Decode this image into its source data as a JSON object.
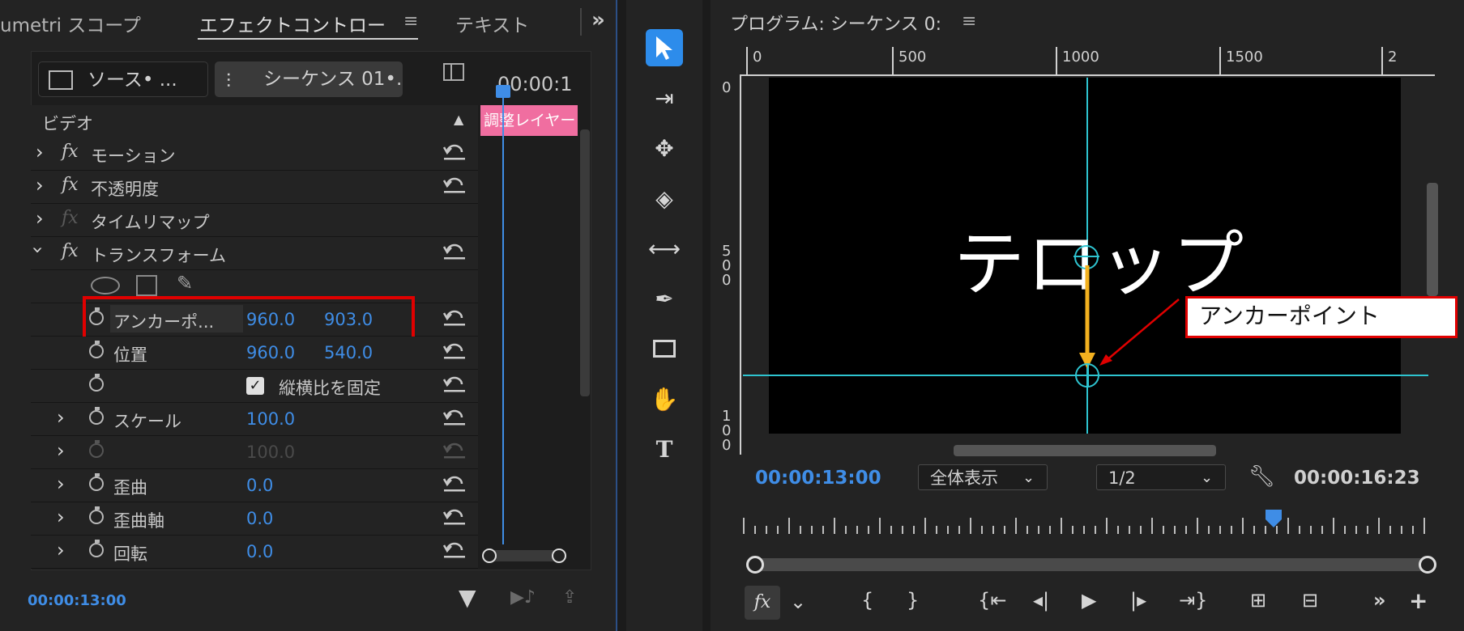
{
  "left_panel": {
    "tabs": [
      "umetri スコープ",
      "エフェクトコントロー",
      "テキスト"
    ],
    "overflow_glyph": "»",
    "source_button": "ソース• ...",
    "sequence_button": "シーケンス 01•...",
    "timecode_header": "00:00:1",
    "adjust_layer_clip": "調整レイヤー",
    "section_label": "ビデオ",
    "effects": [
      {
        "label": "モーション"
      },
      {
        "label": "不透明度"
      },
      {
        "label": "タイムリマップ"
      },
      {
        "label": "トランスフォーム"
      }
    ],
    "properties": {
      "anchor_label": "アンカーポ...",
      "anchor_x": "960.0",
      "anchor_y": "903.0",
      "position_label": "位置",
      "position_x": "960.0",
      "position_y": "540.0",
      "aspect_label": "縦横比を固定",
      "scale_label": "スケール",
      "scale_value": "100.0",
      "scale_width_value": "100.0",
      "skew_label": "歪曲",
      "skew_value": "0.0",
      "skew_axis_label": "歪曲軸",
      "skew_axis_value": "0.0",
      "rotation_label": "回転",
      "rotation_value": "0.0"
    },
    "footer_timecode": "00:00:13:00"
  },
  "toolbar": {
    "tools": [
      "selection-tool",
      "track-select-tool",
      "ripple-edit-tool",
      "razor-tool",
      "slip-tool",
      "pen-tool",
      "rectangle-tool",
      "hand-tool",
      "type-tool"
    ]
  },
  "program_monitor": {
    "title": "プログラム: シーケンス 0:",
    "ruler_top": [
      "0",
      "500",
      "1000",
      "1500",
      "2"
    ],
    "ruler_left": [
      "0",
      "5\n0\n0",
      "1\n0\n0"
    ],
    "caption_text": "テロップ",
    "annotation_text": "アンカーポイント",
    "current_timecode": "00:00:13:00",
    "zoom_select": "全体表示",
    "resolution_select": "1/2",
    "duration_timecode": "00:00:16:23",
    "playhead_fraction": 0.78
  },
  "colors": {
    "accent_blue": "#3f8de6",
    "highlight_red": "#e00000",
    "clip_pink": "#f06ea0",
    "guide_cyan": "#2ec4d0",
    "arrow_orange": "#f3b11f"
  }
}
